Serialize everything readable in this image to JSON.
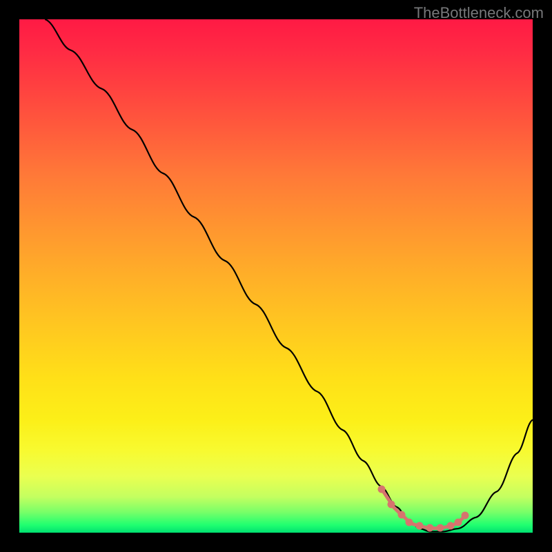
{
  "watermark": "TheBottleneck.com",
  "chart_data": {
    "type": "line",
    "title": "",
    "xlabel": "",
    "ylabel": "",
    "xlim": [
      0,
      100
    ],
    "ylim": [
      0,
      100
    ],
    "series": [
      {
        "name": "curve",
        "x": [
          5,
          10,
          16,
          22,
          28,
          34,
          40,
          46,
          52,
          58,
          63,
          67,
          70.5,
          73.5,
          76,
          78,
          80,
          82.5,
          85.5,
          89,
          93,
          97,
          100
        ],
        "y": [
          100,
          94,
          86.5,
          78.5,
          70,
          61.5,
          53,
          44.5,
          36,
          27.5,
          20,
          14,
          9,
          5,
          2.2,
          0.8,
          0.2,
          0.2,
          0.8,
          3,
          8,
          15.5,
          22
        ],
        "color": "#000000"
      }
    ],
    "highlight": {
      "name": "valley-marker",
      "color": "#d6746e",
      "dots": [
        {
          "x": 70.5,
          "y": 8.5
        },
        {
          "x": 72.5,
          "y": 5.5
        },
        {
          "x": 74.5,
          "y": 3.5
        },
        {
          "x": 76,
          "y": 2
        },
        {
          "x": 78,
          "y": 1.3
        },
        {
          "x": 80,
          "y": 0.9
        },
        {
          "x": 82,
          "y": 0.9
        },
        {
          "x": 84,
          "y": 1.3
        },
        {
          "x": 85.5,
          "y": 2
        },
        {
          "x": 86.8,
          "y": 3.3
        }
      ]
    }
  }
}
